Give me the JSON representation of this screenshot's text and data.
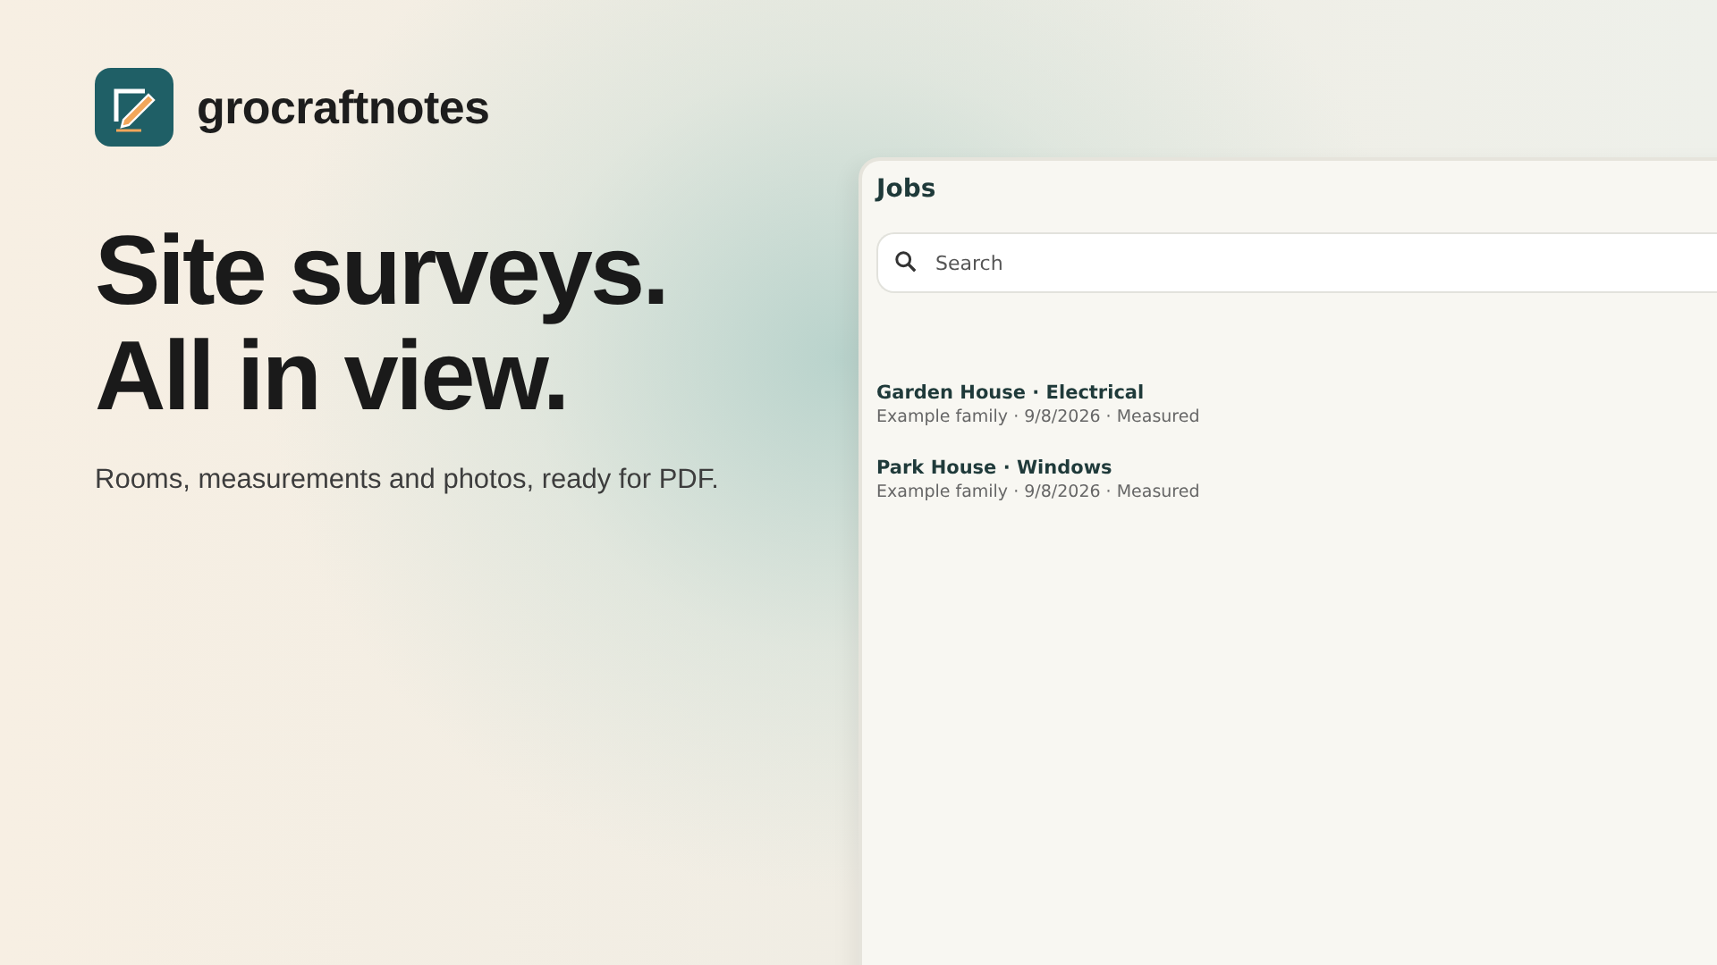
{
  "brand": {
    "name": "grocraftnotes"
  },
  "hero": {
    "headline_lines": [
      "Site surveys.",
      "All in view."
    ],
    "subtitle": "Rooms, measurements and photos, ready for PDF."
  },
  "app": {
    "title": "Jobs",
    "search": {
      "placeholder": "Search"
    },
    "jobs": [
      {
        "title": "Garden House · Electrical",
        "meta": "Example family · 9/8/2026 · Measured"
      },
      {
        "title": "Park House · Windows",
        "meta": "Example family · 9/8/2026 · Measured"
      }
    ]
  }
}
